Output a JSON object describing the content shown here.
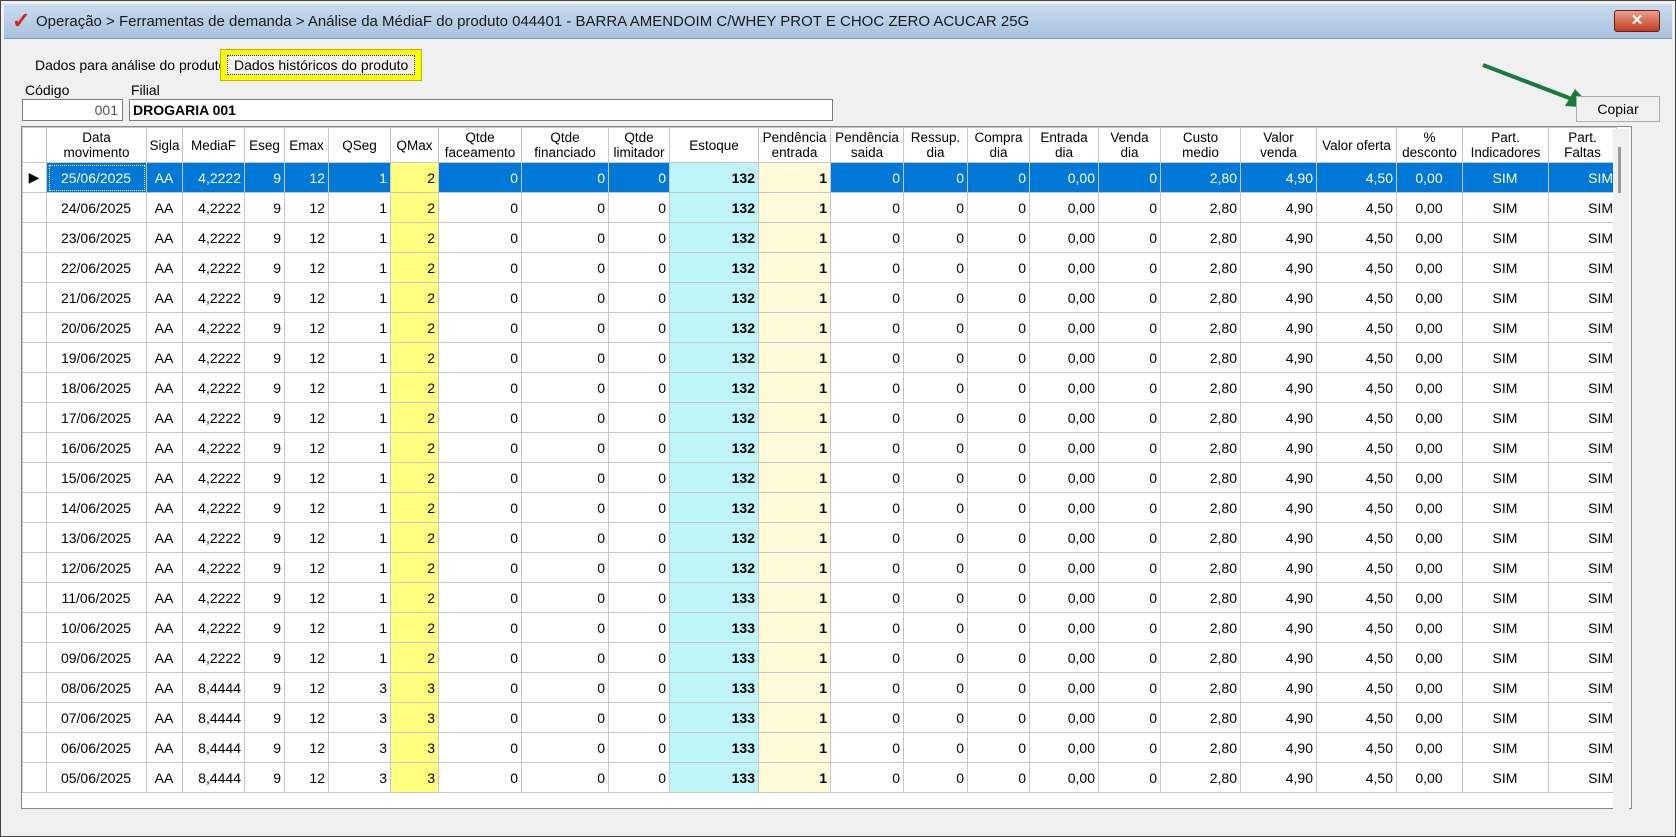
{
  "window": {
    "logo": "✓",
    "title": "Operação > Ferramentas de demanda > Análise da MédiaF do produto 044401 - BARRA AMENDOIM C/WHEY PROT E CHOC ZERO ACUCAR 25G",
    "close_label": "✕"
  },
  "tabs": [
    {
      "label": "Dados para análise do produto"
    },
    {
      "label": "Dados históricos do produto",
      "active": true
    }
  ],
  "form": {
    "codigo_label": "Código",
    "codigo_value": "001",
    "filial_label": "Filial",
    "filial_value": "DROGARIA 001"
  },
  "copiar_label": "Copiar",
  "grid": {
    "columns": [
      "Data movimento",
      "Sigla",
      "MediaF",
      "Eseg",
      "Emax",
      "QSeg",
      "QMax",
      "Qtde faceamento",
      "Qtde financiado",
      "Qtde limitador",
      "Estoque",
      "Pendência entrada",
      "Pendência saida",
      "Ressup. dia",
      "Compra dia",
      "Entrada dia",
      "Venda dia",
      "Custo medio",
      "Valor venda",
      "Valor oferta",
      "% desconto",
      "Part. Indicadores",
      "Part. Faltas"
    ],
    "rows": [
      [
        "25/06/2025",
        "AA",
        "4,2222",
        "9",
        "12",
        "1",
        "2",
        "0",
        "0",
        "0",
        "132",
        "1",
        "0",
        "0",
        "0",
        "0,00",
        "0",
        "2,80",
        "4,90",
        "4,50",
        "0,00",
        "SIM",
        "SIM"
      ],
      [
        "24/06/2025",
        "AA",
        "4,2222",
        "9",
        "12",
        "1",
        "2",
        "0",
        "0",
        "0",
        "132",
        "1",
        "0",
        "0",
        "0",
        "0,00",
        "0",
        "2,80",
        "4,90",
        "4,50",
        "0,00",
        "SIM",
        "SIM"
      ],
      [
        "23/06/2025",
        "AA",
        "4,2222",
        "9",
        "12",
        "1",
        "2",
        "0",
        "0",
        "0",
        "132",
        "1",
        "0",
        "0",
        "0",
        "0,00",
        "0",
        "2,80",
        "4,90",
        "4,50",
        "0,00",
        "SIM",
        "SIM"
      ],
      [
        "22/06/2025",
        "AA",
        "4,2222",
        "9",
        "12",
        "1",
        "2",
        "0",
        "0",
        "0",
        "132",
        "1",
        "0",
        "0",
        "0",
        "0,00",
        "0",
        "2,80",
        "4,90",
        "4,50",
        "0,00",
        "SIM",
        "SIM"
      ],
      [
        "21/06/2025",
        "AA",
        "4,2222",
        "9",
        "12",
        "1",
        "2",
        "0",
        "0",
        "0",
        "132",
        "1",
        "0",
        "0",
        "0",
        "0,00",
        "0",
        "2,80",
        "4,90",
        "4,50",
        "0,00",
        "SIM",
        "SIM"
      ],
      [
        "20/06/2025",
        "AA",
        "4,2222",
        "9",
        "12",
        "1",
        "2",
        "0",
        "0",
        "0",
        "132",
        "1",
        "0",
        "0",
        "0",
        "0,00",
        "0",
        "2,80",
        "4,90",
        "4,50",
        "0,00",
        "SIM",
        "SIM"
      ],
      [
        "19/06/2025",
        "AA",
        "4,2222",
        "9",
        "12",
        "1",
        "2",
        "0",
        "0",
        "0",
        "132",
        "1",
        "0",
        "0",
        "0",
        "0,00",
        "0",
        "2,80",
        "4,90",
        "4,50",
        "0,00",
        "SIM",
        "SIM"
      ],
      [
        "18/06/2025",
        "AA",
        "4,2222",
        "9",
        "12",
        "1",
        "2",
        "0",
        "0",
        "0",
        "132",
        "1",
        "0",
        "0",
        "0",
        "0,00",
        "0",
        "2,80",
        "4,90",
        "4,50",
        "0,00",
        "SIM",
        "SIM"
      ],
      [
        "17/06/2025",
        "AA",
        "4,2222",
        "9",
        "12",
        "1",
        "2",
        "0",
        "0",
        "0",
        "132",
        "1",
        "0",
        "0",
        "0",
        "0,00",
        "0",
        "2,80",
        "4,90",
        "4,50",
        "0,00",
        "SIM",
        "SIM"
      ],
      [
        "16/06/2025",
        "AA",
        "4,2222",
        "9",
        "12",
        "1",
        "2",
        "0",
        "0",
        "0",
        "132",
        "1",
        "0",
        "0",
        "0",
        "0,00",
        "0",
        "2,80",
        "4,90",
        "4,50",
        "0,00",
        "SIM",
        "SIM"
      ],
      [
        "15/06/2025",
        "AA",
        "4,2222",
        "9",
        "12",
        "1",
        "2",
        "0",
        "0",
        "0",
        "132",
        "1",
        "0",
        "0",
        "0",
        "0,00",
        "0",
        "2,80",
        "4,90",
        "4,50",
        "0,00",
        "SIM",
        "SIM"
      ],
      [
        "14/06/2025",
        "AA",
        "4,2222",
        "9",
        "12",
        "1",
        "2",
        "0",
        "0",
        "0",
        "132",
        "1",
        "0",
        "0",
        "0",
        "0,00",
        "0",
        "2,80",
        "4,90",
        "4,50",
        "0,00",
        "SIM",
        "SIM"
      ],
      [
        "13/06/2025",
        "AA",
        "4,2222",
        "9",
        "12",
        "1",
        "2",
        "0",
        "0",
        "0",
        "132",
        "1",
        "0",
        "0",
        "0",
        "0,00",
        "0",
        "2,80",
        "4,90",
        "4,50",
        "0,00",
        "SIM",
        "SIM"
      ],
      [
        "12/06/2025",
        "AA",
        "4,2222",
        "9",
        "12",
        "1",
        "2",
        "0",
        "0",
        "0",
        "132",
        "1",
        "0",
        "0",
        "0",
        "0,00",
        "0",
        "2,80",
        "4,90",
        "4,50",
        "0,00",
        "SIM",
        "SIM"
      ],
      [
        "11/06/2025",
        "AA",
        "4,2222",
        "9",
        "12",
        "1",
        "2",
        "0",
        "0",
        "0",
        "133",
        "1",
        "0",
        "0",
        "0",
        "0,00",
        "0",
        "2,80",
        "4,90",
        "4,50",
        "0,00",
        "SIM",
        "SIM"
      ],
      [
        "10/06/2025",
        "AA",
        "4,2222",
        "9",
        "12",
        "1",
        "2",
        "0",
        "0",
        "0",
        "133",
        "1",
        "0",
        "0",
        "0",
        "0,00",
        "0",
        "2,80",
        "4,90",
        "4,50",
        "0,00",
        "SIM",
        "SIM"
      ],
      [
        "09/06/2025",
        "AA",
        "4,2222",
        "9",
        "12",
        "1",
        "2",
        "0",
        "0",
        "0",
        "133",
        "1",
        "0",
        "0",
        "0",
        "0,00",
        "0",
        "2,80",
        "4,90",
        "4,50",
        "0,00",
        "SIM",
        "SIM"
      ],
      [
        "08/06/2025",
        "AA",
        "8,4444",
        "9",
        "12",
        "3",
        "3",
        "0",
        "0",
        "0",
        "133",
        "1",
        "0",
        "0",
        "0",
        "0,00",
        "0",
        "2,80",
        "4,90",
        "4,50",
        "0,00",
        "SIM",
        "SIM"
      ],
      [
        "07/06/2025",
        "AA",
        "8,4444",
        "9",
        "12",
        "3",
        "3",
        "0",
        "0",
        "0",
        "133",
        "1",
        "0",
        "0",
        "0",
        "0,00",
        "0",
        "2,80",
        "4,90",
        "4,50",
        "0,00",
        "SIM",
        "SIM"
      ],
      [
        "06/06/2025",
        "AA",
        "8,4444",
        "9",
        "12",
        "3",
        "3",
        "0",
        "0",
        "0",
        "133",
        "1",
        "0",
        "0",
        "0",
        "0,00",
        "0",
        "2,80",
        "4,90",
        "4,50",
        "0,00",
        "SIM",
        "SIM"
      ],
      [
        "05/06/2025",
        "AA",
        "8,4444",
        "9",
        "12",
        "3",
        "3",
        "0",
        "0",
        "0",
        "133",
        "1",
        "0",
        "0",
        "0",
        "0,00",
        "0",
        "2,80",
        "4,90",
        "4,50",
        "0,00",
        "SIM",
        "SIM"
      ]
    ],
    "selected_row": 0,
    "current_row_marker": "▶"
  },
  "colors": {
    "selection": "#0078d7",
    "qmax_highlight": "#ffff80",
    "estoque_highlight": "#bff4f8",
    "pendencia_highlight": "#fffbd8",
    "tab_highlight": "#ffff00",
    "arrow": "#1a7a3e"
  }
}
